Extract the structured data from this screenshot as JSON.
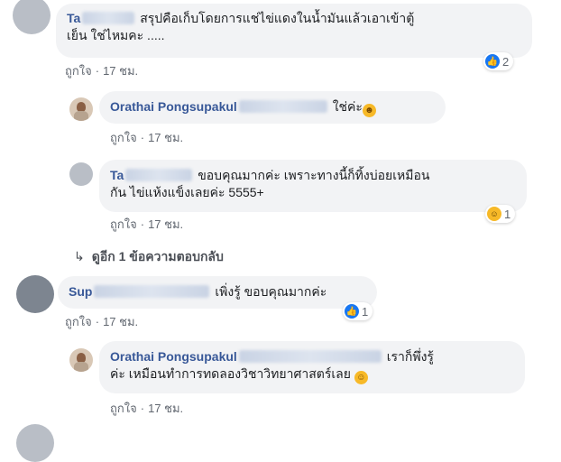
{
  "comments": [
    {
      "author_visible": "Ta",
      "text_line1": "สรุปคือเก็บโดยการแช่ไข่แดงในน้ำมันแล้วเอาเข้าตู้",
      "text_line2": "เย็น ใช่ไหมคะ .....",
      "like_label": "ถูกใจ",
      "time": "17 ชม.",
      "reaction": {
        "type": "like-icon",
        "count": "2"
      }
    },
    {
      "author": "Orathai Pongsupakul",
      "text": "ใช่ค่ะ",
      "emoji": "smiling-face-icon",
      "like_label": "ถูกใจ",
      "time": "17 ชม."
    },
    {
      "author_visible": "Ta",
      "text_line1": "ขอบคุณมากค่ะ เพราะทางนี้ก็ทิ้งบ่อยเหมือน",
      "text_line2": "กัน ไข่แห้งแข็งเลยค่ะ 5555+",
      "like_label": "ถูกใจ",
      "time": "17 ชม.",
      "reaction": {
        "type": "haha-icon",
        "count": "1"
      }
    },
    {
      "author_visible": "Sup",
      "text": "เพิ่งรู้ ขอบคุณมากค่ะ",
      "like_label": "ถูกใจ",
      "time": "17 ชม.",
      "reaction": {
        "type": "like-icon",
        "count": "1"
      }
    },
    {
      "author": "Orathai Pongsupakul",
      "text_line1": "เราก็พึ่งรู้",
      "text_line2": "ค่ะ เหมือนทำการทดลองวิชาวิทยาศาสตร์เลย",
      "emoji": "laughing-face-icon",
      "like_label": "ถูกใจ",
      "time": "17 ชม."
    }
  ],
  "more_replies": "ดูอีก 1 ข้อความตอบกลับ",
  "colors": {
    "name": "#385898",
    "bubble": "#f2f3f5",
    "meta": "#616770",
    "like_blue": "#1877f2"
  }
}
